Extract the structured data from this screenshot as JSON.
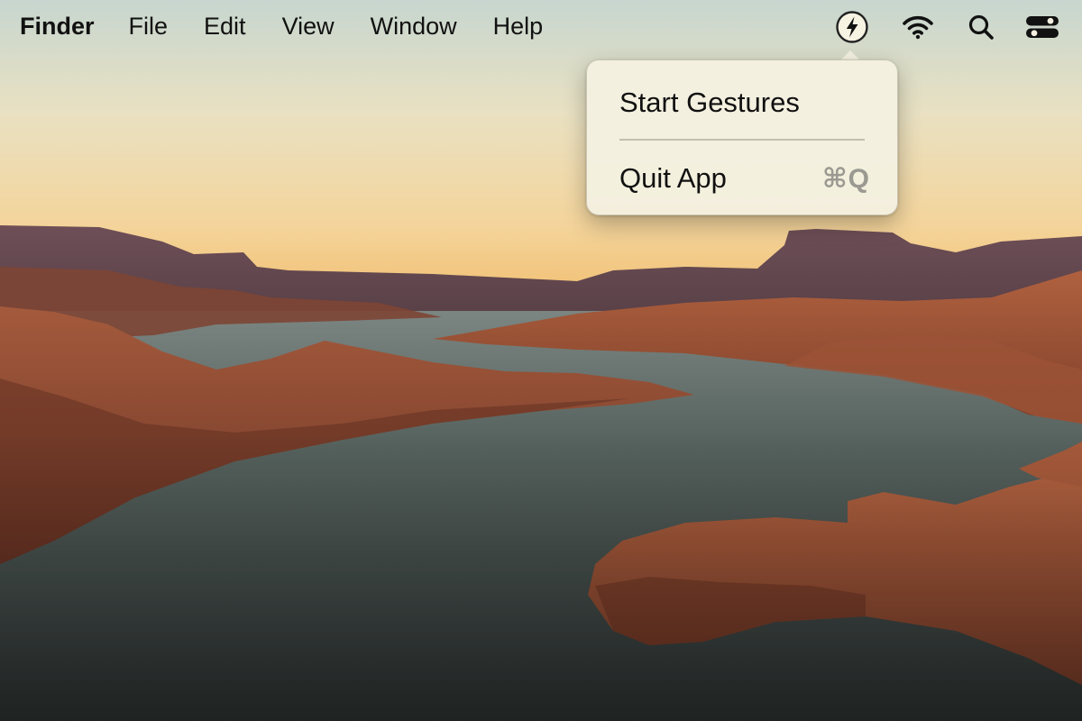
{
  "menubar": {
    "app_name": "Finder",
    "menus": [
      "File",
      "Edit",
      "View",
      "Window",
      "Help"
    ]
  },
  "status_icons": {
    "app": "lightning-bolt-icon",
    "wifi": "wifi-icon",
    "search": "search-icon",
    "control_center": "control-center-icon"
  },
  "dropdown": {
    "items": [
      {
        "label": "Start Gestures",
        "shortcut": ""
      },
      {
        "label": "Quit App",
        "shortcut": "⌘Q"
      }
    ]
  },
  "colors": {
    "sky_top": "#c9d7cf",
    "sky_horizon": "#f2c070",
    "rock": "#9a5036",
    "water": "#4d5854",
    "menu_bg": "#f4f1e2"
  }
}
